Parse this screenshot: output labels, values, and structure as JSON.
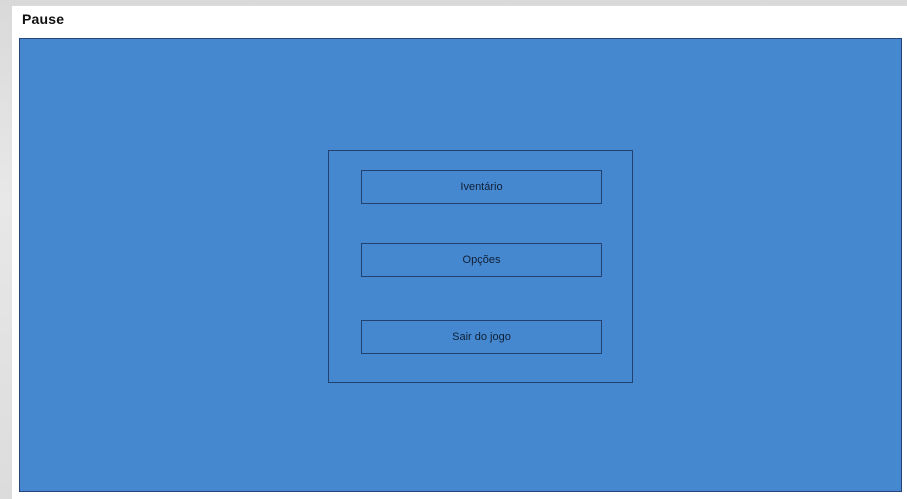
{
  "header": {
    "title": "Pause"
  },
  "pause_menu": {
    "items": [
      {
        "label": "Iventário"
      },
      {
        "label": "Opções"
      },
      {
        "label": "Sair do jogo"
      }
    ]
  },
  "colors": {
    "screen_background": "#4688d0",
    "outline": "#22416f"
  }
}
